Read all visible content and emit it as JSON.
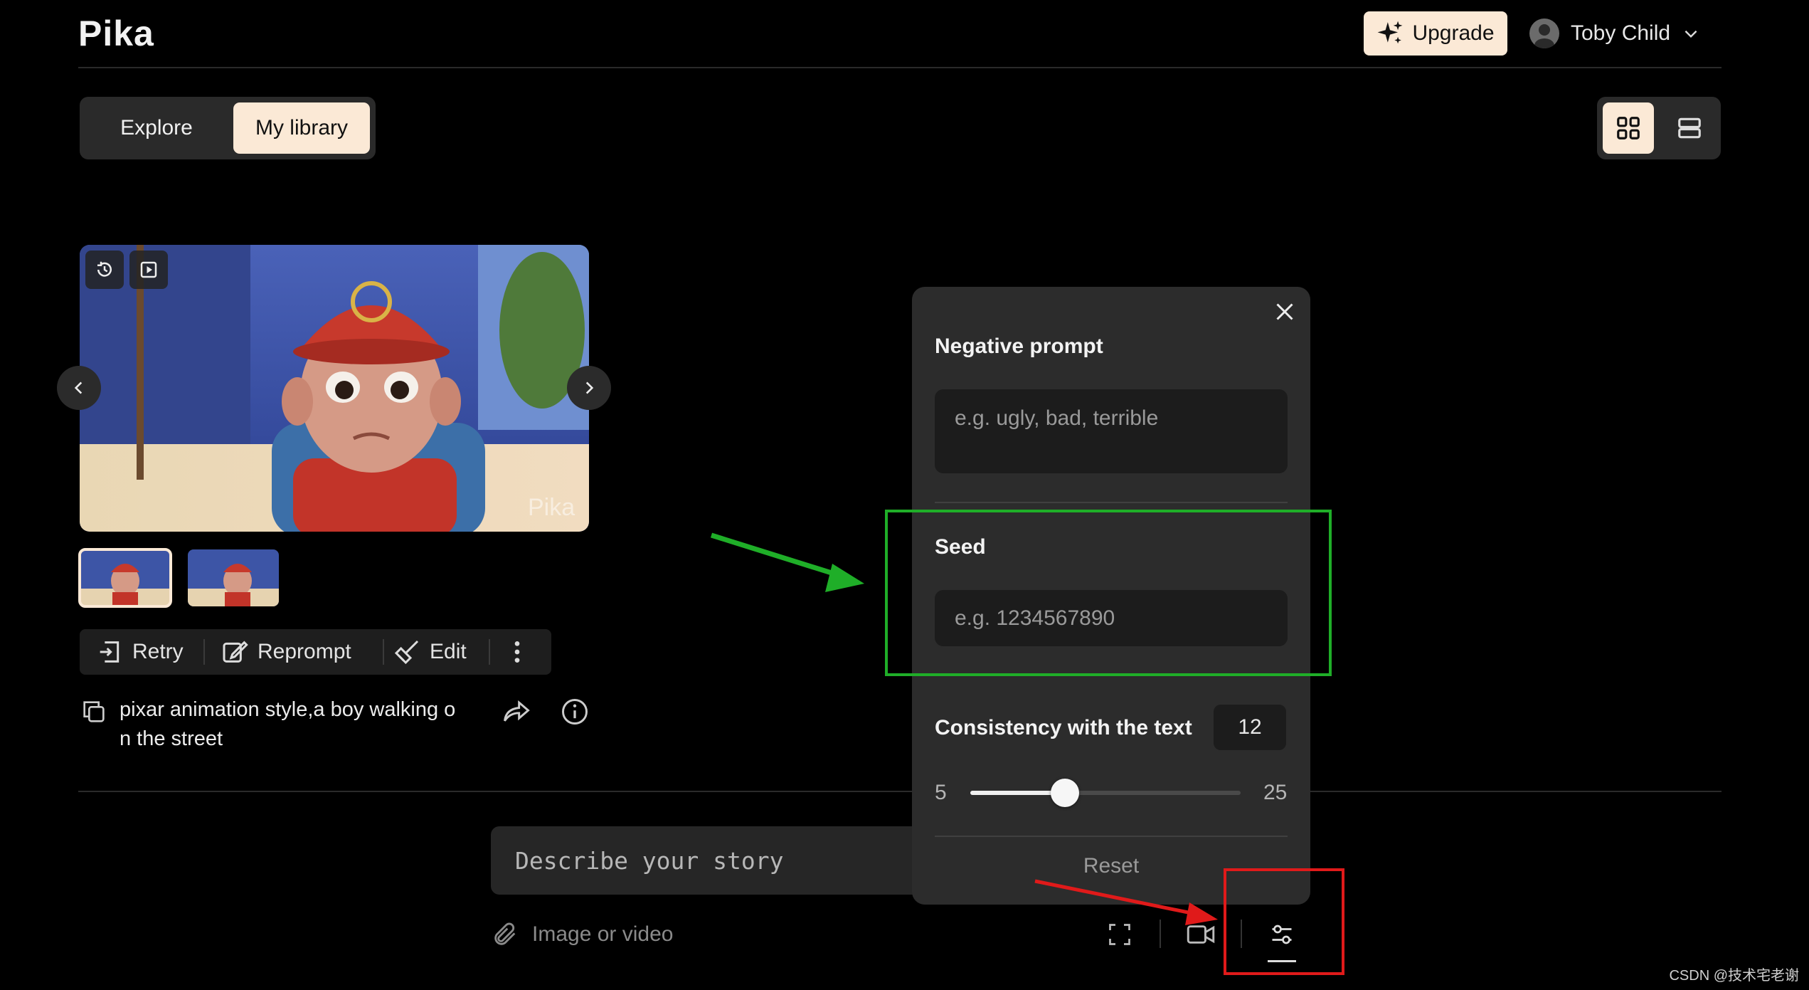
{
  "header": {
    "logo": "Pika",
    "upgrade_label": "Upgrade",
    "user_name": "Toby Child"
  },
  "tabs": [
    {
      "label": "Explore",
      "active": false
    },
    {
      "label": "My library",
      "active": true
    }
  ],
  "view_toggle": {
    "active": "grid"
  },
  "video": {
    "watermark": "Pika",
    "thumbnail_count": 2,
    "selected_thumbnail": 1
  },
  "actions": {
    "retry": "Retry",
    "reprompt": "Reprompt",
    "edit": "Edit"
  },
  "prompt_text": "pixar animation style,a boy walking o\nn the street",
  "composer": {
    "story_placeholder": "Describe your story",
    "attach_label": "Image or video"
  },
  "settings_panel": {
    "negative_prompt_label": "Negative prompt",
    "negative_prompt_placeholder": "e.g. ugly, bad, terrible",
    "seed_label": "Seed",
    "seed_placeholder": "e.g. 1234567890",
    "consistency_label": "Consistency with the text",
    "consistency_value": "12",
    "slider_min": "5",
    "slider_max": "25",
    "reset_label": "Reset"
  },
  "colors": {
    "accent": "#fbe9d6",
    "panel_bg": "#2c2c2c",
    "annotation_green": "#1fae28",
    "annotation_red": "#e01a1a"
  },
  "watermark_text": "CSDN @技术宅老谢"
}
